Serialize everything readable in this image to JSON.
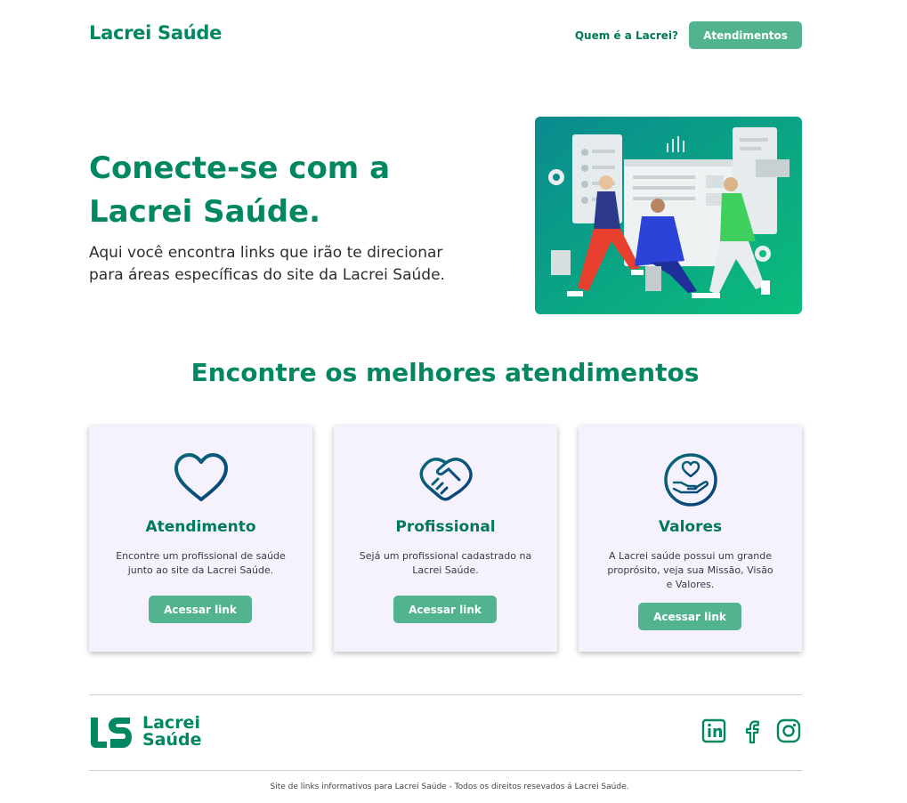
{
  "header": {
    "logo": "Lacrei Saúde",
    "nav_link": "Quem é a Lacrei?",
    "nav_button": "Atendimentos"
  },
  "hero": {
    "title": "Conecte-se com a Lacrei Saúde.",
    "text": "Aqui você encontra links que irão te direcionar para áreas específicas do site da Lacrei Saúde.",
    "illustration": "people-at-dashboard-illustration"
  },
  "section": {
    "title": "Encontre os melhores atendimentos"
  },
  "cards": [
    {
      "icon": "heart-icon",
      "title": "Atendimento",
      "text": "Encontre um profissional de saúde junto ao site da Lacrei Saúde.",
      "button": "Acessar link"
    },
    {
      "icon": "handshake-icon",
      "title": "Profissional",
      "text": "Sejá um profissional cadastrado na Lacrei Saúde.",
      "button": "Acessar link"
    },
    {
      "icon": "hand-heart-icon",
      "title": "Valores",
      "text": "A Lacrei saúde possui um grande proprósito, veja sua Missão, Visão e Valores.",
      "button": "Acessar link"
    }
  ],
  "footer": {
    "logo_line1": "Lacrei",
    "logo_line2": "Saúde",
    "social": [
      "linkedin-icon",
      "facebook-icon",
      "instagram-icon"
    ],
    "copyright": "Site de links informativos para Lacrei Saúde - Todos os direitos resevados á Lacrei Saúde."
  },
  "colors": {
    "brand_green": "#018762",
    "button_green": "#51b48f",
    "card_bg": "#f6f2fd",
    "icon_teal": "#0b6a78"
  }
}
